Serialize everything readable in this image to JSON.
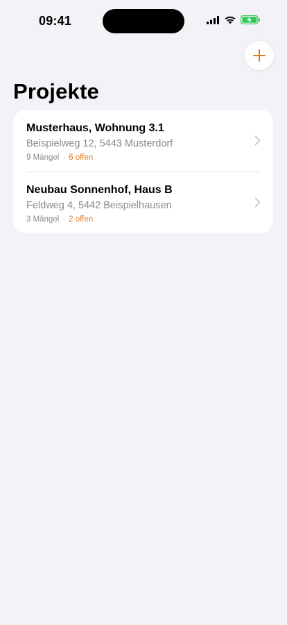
{
  "status_bar": {
    "time": "09:41"
  },
  "header": {
    "title": "Projekte",
    "add_icon": "plus-icon"
  },
  "colors": {
    "accent": "#e07a1f",
    "background": "#f2f2f7",
    "battery_green": "#34c759"
  },
  "projects": [
    {
      "name": "Musterhaus, Wohnung 3.1",
      "address": "Beispielweg 12, 5443 Musterdorf",
      "defects": "9 Mängel",
      "separator": "·",
      "open": "6 offen"
    },
    {
      "name": "Neubau Sonnenhof, Haus B",
      "address": "Feldweg 4, 5442 Beispielhausen",
      "defects": "3 Mängel",
      "separator": "·",
      "open": "2 offen"
    }
  ]
}
